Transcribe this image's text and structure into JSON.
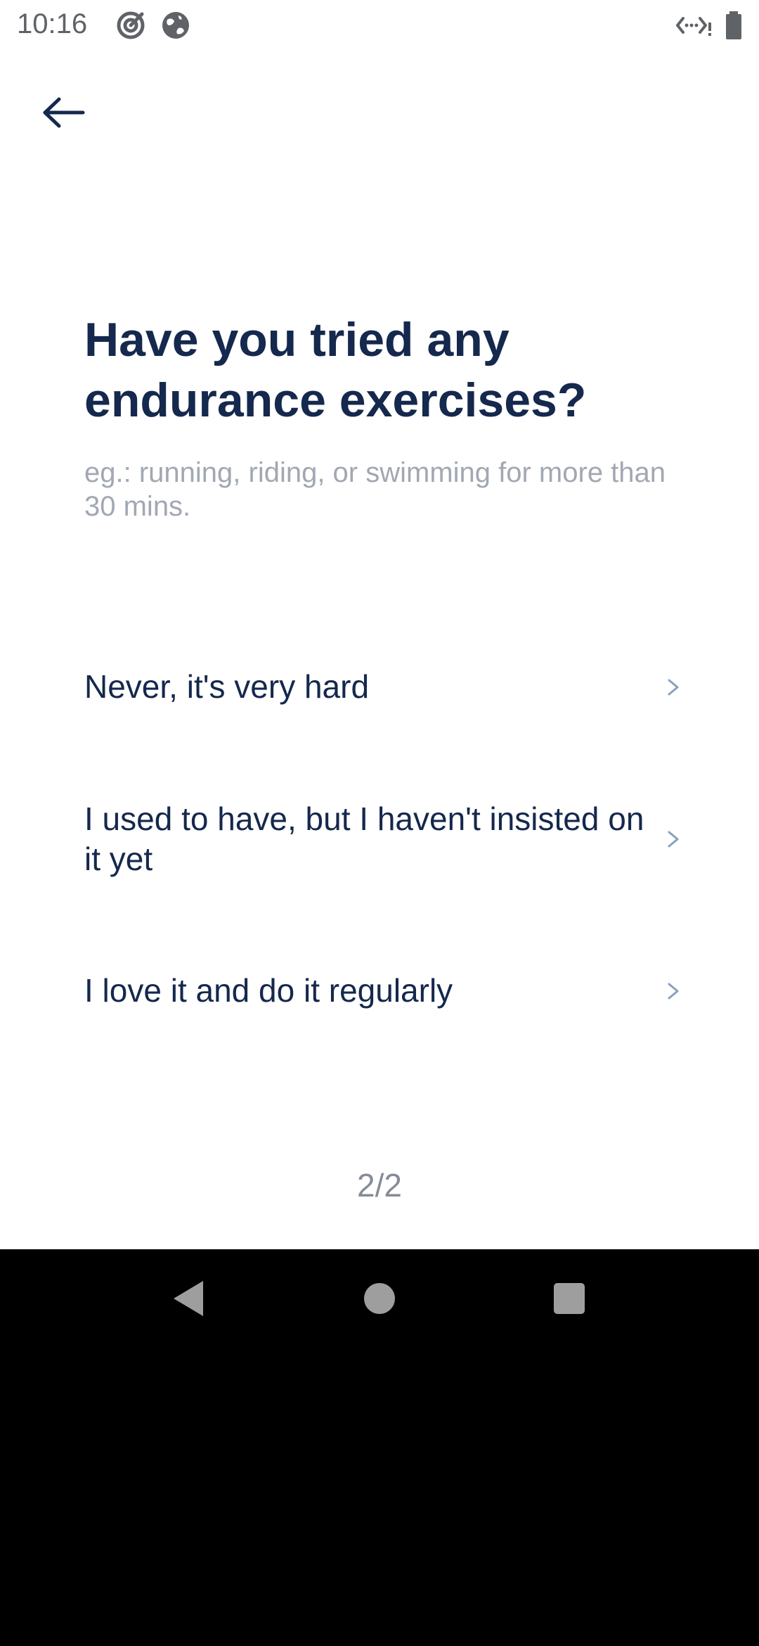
{
  "status_bar": {
    "time": "10:16",
    "icons": [
      "target-icon",
      "globe-icon",
      "signal-icon",
      "battery-icon"
    ]
  },
  "header": {
    "back_icon": "arrow-left-icon"
  },
  "question": {
    "title": "Have you tried any endurance exercises?",
    "hint": "eg.: running, riding, or swimming for more than 30 mins."
  },
  "options": [
    {
      "label": "Never, it's very hard",
      "icon": "chevron-right-icon"
    },
    {
      "label": "I used to have, but I haven't insisted on it yet",
      "icon": "chevron-right-icon"
    },
    {
      "label": "I love it and do it regularly",
      "icon": "chevron-right-icon"
    }
  ],
  "progress": {
    "text": "2/2"
  },
  "nav_bar": {
    "icons": [
      "nav-back-icon",
      "nav-home-icon",
      "nav-recents-icon"
    ]
  },
  "colors": {
    "primary_text": "#15284d",
    "hint_text": "#a1a8b3",
    "chevron": "#8aa0c0",
    "progress_text": "#858c97",
    "status_icons": "#5f6368",
    "nav_icons": "#9e9e9e"
  }
}
